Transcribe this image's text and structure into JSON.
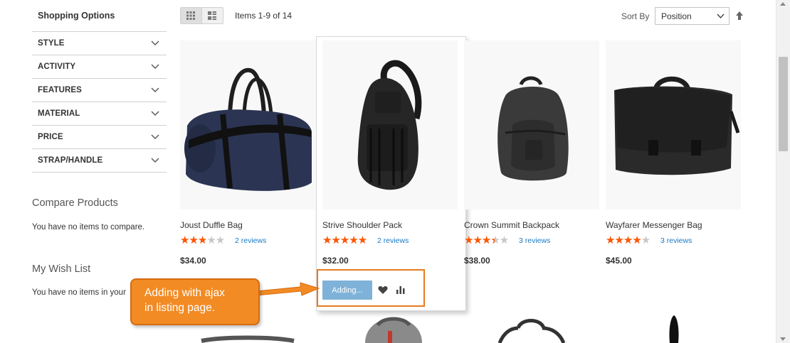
{
  "sidebar": {
    "title": "Shopping Options",
    "filters": [
      {
        "label": "STYLE"
      },
      {
        "label": "ACTIVITY"
      },
      {
        "label": "FEATURES"
      },
      {
        "label": "MATERIAL"
      },
      {
        "label": "PRICE"
      },
      {
        "label": "STRAP/HANDLE"
      }
    ],
    "compare": {
      "title": "Compare Products",
      "text": "You have no items to compare."
    },
    "wishlist": {
      "title": "My Wish List",
      "text": "You have no items in your"
    }
  },
  "toolbar": {
    "modes": [
      {
        "name": "grid",
        "icon": "grid-icon",
        "active": true
      },
      {
        "name": "list",
        "icon": "list-icon",
        "active": false
      }
    ],
    "amount": "Items 1-9 of 14",
    "sort_label": "Sort By",
    "sort_value": "Position",
    "sort_direction_icon": "arrow-up-icon"
  },
  "products": [
    {
      "name": "Joust Duffle Bag",
      "rating": 0.5,
      "reviews": "2 reviews",
      "price": "$34.00"
    },
    {
      "name": "Strive Shoulder Pack",
      "rating": 0.9,
      "reviews": "2 reviews",
      "price": "$32.00"
    },
    {
      "name": "Crown Summit Backpack",
      "rating": 0.6,
      "reviews": "3 reviews",
      "price": "$38.00"
    },
    {
      "name": "Wayfarer Messenger Bag",
      "rating": 0.7,
      "reviews": "3 reviews",
      "price": "$45.00"
    }
  ],
  "hover_actions": {
    "add_label": "Adding...",
    "wishlist_icon": "heart-icon",
    "compare_icon": "bar-chart-icon"
  },
  "annotation": {
    "lines": [
      "Adding with ajax",
      "in listing page."
    ]
  },
  "colors": {
    "star": "#ff5501",
    "link": "#1979c3",
    "adding_button": "#7fb2d8",
    "callout": "#f28b24",
    "callout_border": "#d66b0e"
  },
  "icons": {
    "filter_expand": "chevron-down-icon",
    "sort_select": "chevron-down-icon"
  }
}
